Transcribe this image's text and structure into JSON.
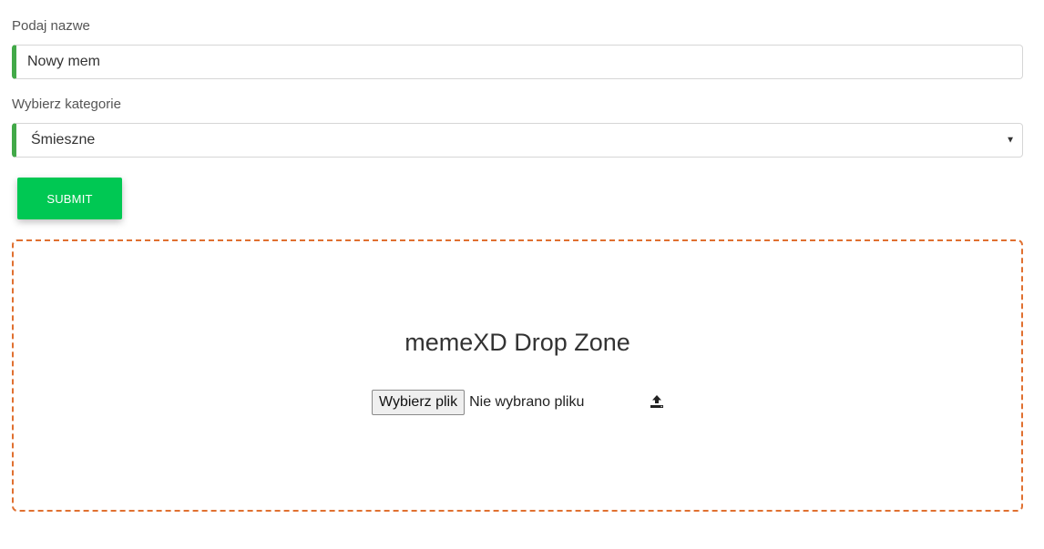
{
  "form": {
    "name_label": "Podaj nazwe",
    "name_value": "Nowy mem",
    "category_label": "Wybierz kategorie",
    "category_selected": "Śmieszne",
    "submit_label": "SUBMIT"
  },
  "drop_zone": {
    "title": "memeXD Drop Zone",
    "choose_file_label": "Wybierz plik",
    "file_status": "Nie wybrano pliku",
    "icon": "upload-icon"
  },
  "colors": {
    "valid_accent": "#42a948",
    "submit_bg": "#00c853",
    "drop_border": "#e07030"
  }
}
